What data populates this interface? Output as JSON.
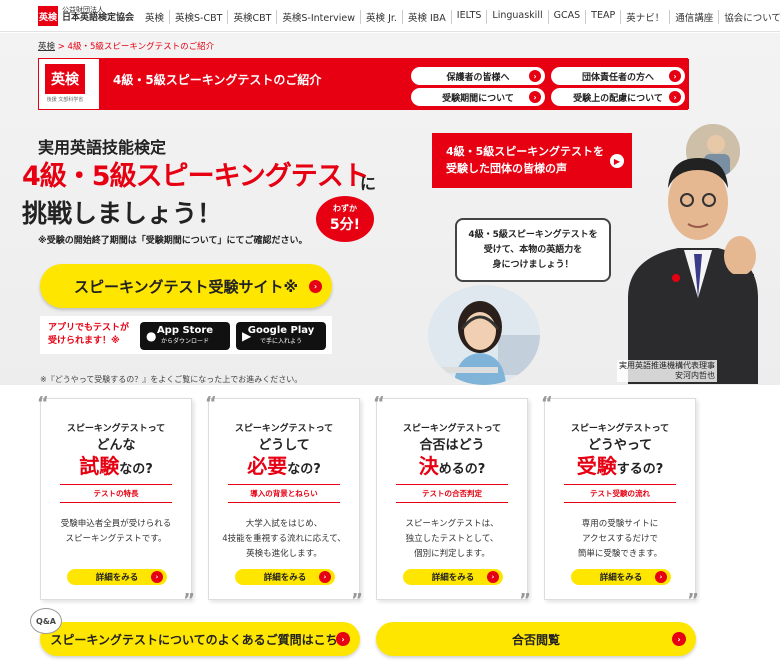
{
  "header": {
    "logo_mark": "英検",
    "org_small": "公益財団法人",
    "org_name": "日本英語検定協会",
    "nav": [
      "英検",
      "英検S-CBT",
      "英検CBT",
      "英検S-Interview",
      "英検 Jr.",
      "英検 IBA",
      "IELTS",
      "Linguaskill",
      "GCAS",
      "TEAP",
      "英ナビ！",
      "通信講座",
      "協会について"
    ]
  },
  "breadcrumb": {
    "home": "英検",
    "sep": ">",
    "current": "4級・5級スピーキングテストのご紹介"
  },
  "redbar": {
    "logo": "英検",
    "logo_sub": "後援 文部科学省",
    "title": "4級・5級スピーキングテストのご紹介",
    "links": [
      "保護者の皆様へ",
      "団体責任者の方へ",
      "受験期間について",
      "受験上の配慮について"
    ]
  },
  "hero": {
    "sub": "実用英語技能検定",
    "main": "4級・5級スピーキングテスト",
    "ni": "に",
    "main2": "挑戦しましょう！",
    "badge_small": "わずか",
    "badge_large": "5分!",
    "note": "※受験の開始終了期間は「受験期間について」にてご確認ださい。",
    "cta": "スピーキングテスト受験サイト※",
    "app_text_1": "アプリでもテストが",
    "app_text_2": "受けられます！※",
    "appstore_1": "App Store",
    "appstore_2": "からダウンロード",
    "googleplay_1": "Google Play",
    "googleplay_2": "で手に入れよう",
    "voice_1": "4級・5級スピーキングテストを",
    "voice_2": "受験した団体の皆様の声",
    "bubble_1": "4級・5級スピーキングテストを",
    "bubble_2": "受けて、本物の英語力を",
    "bubble_3": "身につけましょう！",
    "caption_1": "実用英語推進機構代表理事",
    "caption_2": "安河内哲也"
  },
  "note2": "※『どうやって受験するの？』をよくご覧になった上でお進みください。",
  "cards": [
    {
      "kicker": "スピーキングテストって",
      "line1": "どんな",
      "line2_red": "試験",
      "line2_rest": "なの?",
      "tag": "テストの特長",
      "desc1": "受験申込者全員が受けられる",
      "desc2": "スピーキングテストです。",
      "desc3": "",
      "detail": "詳細をみる"
    },
    {
      "kicker": "スピーキングテストって",
      "line1": "どうして",
      "line2_red": "必要",
      "line2_rest": "なの?",
      "tag": "導入の背景とねらい",
      "desc1": "大学入試をはじめ、",
      "desc2": "4技能を重視する流れに応えて、",
      "desc3": "英検も進化します。",
      "detail": "詳細をみる"
    },
    {
      "kicker": "スピーキングテストって",
      "line1": "合否はどう",
      "line2_red": "決",
      "line2_rest": "めるの?",
      "tag": "テストの合否判定",
      "desc1": "スピーキングテストは、",
      "desc2": "独立したテストとして、",
      "desc3": "個別に判定します。",
      "detail": "詳細をみる"
    },
    {
      "kicker": "スピーキングテストって",
      "line1": "どうやって",
      "line2_red": "受験",
      "line2_rest": "するの?",
      "tag": "テスト受験の流れ",
      "desc1": "専用の受験サイトに",
      "desc2": "アクセスするだけで",
      "desc3": "簡単に受験できます。",
      "detail": "詳細をみる"
    }
  ],
  "bottom": {
    "qa": "Q&A",
    "faq": "スピーキングテストについてのよくあるご質問はこちら",
    "results": "合否閲覧"
  },
  "colors": {
    "brand_red": "#e60012",
    "yellow": "#ffe600"
  }
}
